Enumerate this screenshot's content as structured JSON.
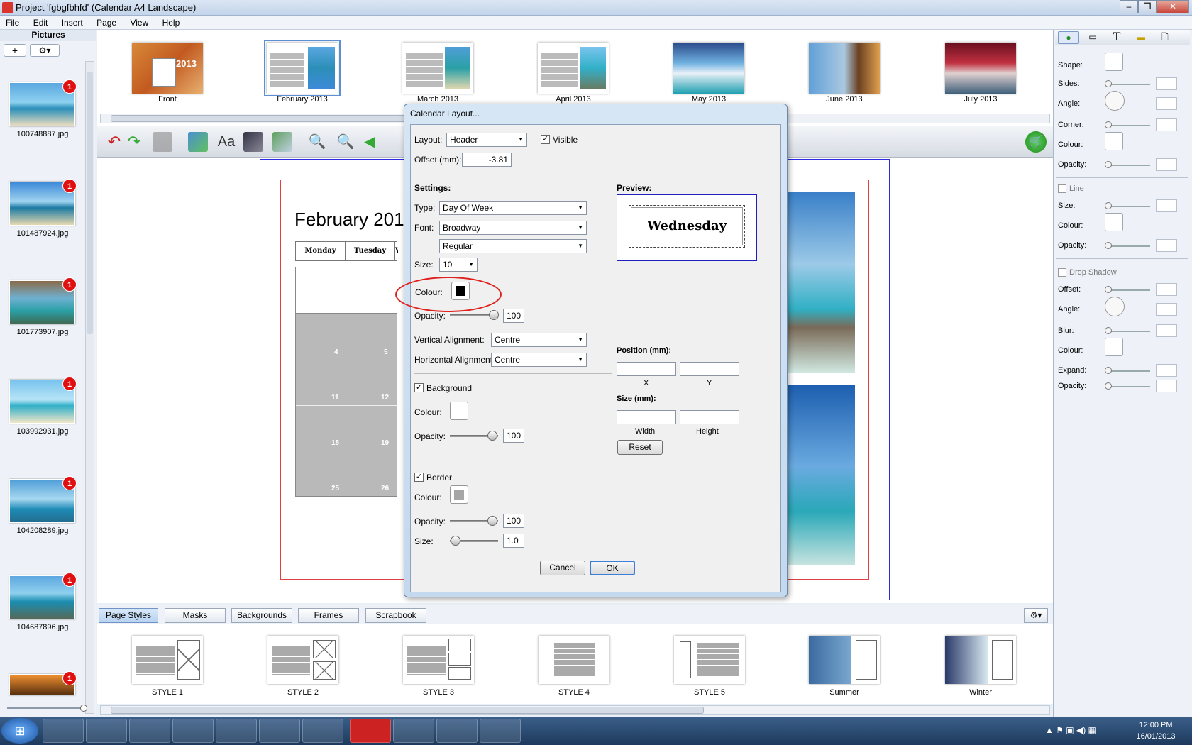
{
  "window": {
    "title": "Project 'fgbgfbhfd' (Calendar A4 Landscape)"
  },
  "menu": [
    "File",
    "Edit",
    "Insert",
    "Page",
    "View",
    "Help"
  ],
  "left_panel": {
    "title": "Pictures",
    "pictures": [
      {
        "name": "100748887.jpg",
        "badge": "1"
      },
      {
        "name": "101487924.jpg",
        "badge": "1"
      },
      {
        "name": "101773907.jpg",
        "badge": "1"
      },
      {
        "name": "103992931.jpg",
        "badge": "1"
      },
      {
        "name": "104208289.jpg",
        "badge": "1"
      },
      {
        "name": "104687896.jpg",
        "badge": "1"
      },
      {
        "name": "",
        "badge": "1"
      }
    ]
  },
  "pages": [
    "Front",
    "February 2013",
    "March 2013",
    "April 2013",
    "May 2013",
    "June 2013",
    "July 2013"
  ],
  "calendar": {
    "month_title": "February 201",
    "days": [
      "Monday",
      "Tuesday",
      "W"
    ],
    "dates": [
      "4",
      "5",
      "11",
      "12",
      "18",
      "19",
      "25",
      "26"
    ]
  },
  "right_panel": {
    "shape": "Shape:",
    "sides": "Sides:",
    "angle": "Angle:",
    "corner": "Corner:",
    "colour": "Colour:",
    "opacity": "Opacity:",
    "line": "Line",
    "size": "Size:",
    "drop_shadow": "Drop Shadow",
    "offset": "Offset:",
    "blur": "Blur:",
    "expand": "Expand:"
  },
  "bottom_tabs": [
    "Page Styles",
    "Masks",
    "Backgrounds",
    "Frames",
    "Scrapbook"
  ],
  "styles": [
    "STYLE 1",
    "STYLE 2",
    "STYLE 3",
    "STYLE 4",
    "STYLE 5",
    "Summer",
    "Winter"
  ],
  "taskbar": {
    "time": "12:00 PM",
    "date": "16/01/2013"
  },
  "dialog": {
    "title": "Calendar Layout...",
    "layout_label": "Layout:",
    "layout_value": "Header",
    "visible_label": "Visible",
    "offset_label": "Offset (mm):",
    "offset_value": "-3.81",
    "settings_label": "Settings:",
    "type_label": "Type:",
    "type_value": "Day Of Week",
    "font_label": "Font:",
    "font_value": "Broadway",
    "font_style": "Regular",
    "size_label": "Size:",
    "size_value": "10",
    "colour_label": "Colour:",
    "opacity_label": "Opacity:",
    "opacity_value": "100",
    "valign_label": "Vertical Alignment:",
    "valign_value": "Centre",
    "halign_label": "Horizontal Alignment",
    "halign_value": "Centre",
    "background_label": "Background",
    "bg_colour_label": "Colour:",
    "bg_opacity_label": "Opacity:",
    "bg_opacity_value": "100",
    "border_label": "Border",
    "border_colour_label": "Colour:",
    "border_opacity_label": "Opacity:",
    "border_opacity_value": "100",
    "border_size_label": "Size:",
    "border_size_value": "1.0",
    "preview_label": "Preview:",
    "preview_text": "Wednesday",
    "position_label": "Position (mm):",
    "x_label": "X",
    "y_label": "Y",
    "size_mm_label": "Size (mm):",
    "width_label": "Width",
    "height_label": "Height",
    "reset_label": "Reset",
    "cancel_label": "Cancel",
    "ok_label": "OK"
  }
}
